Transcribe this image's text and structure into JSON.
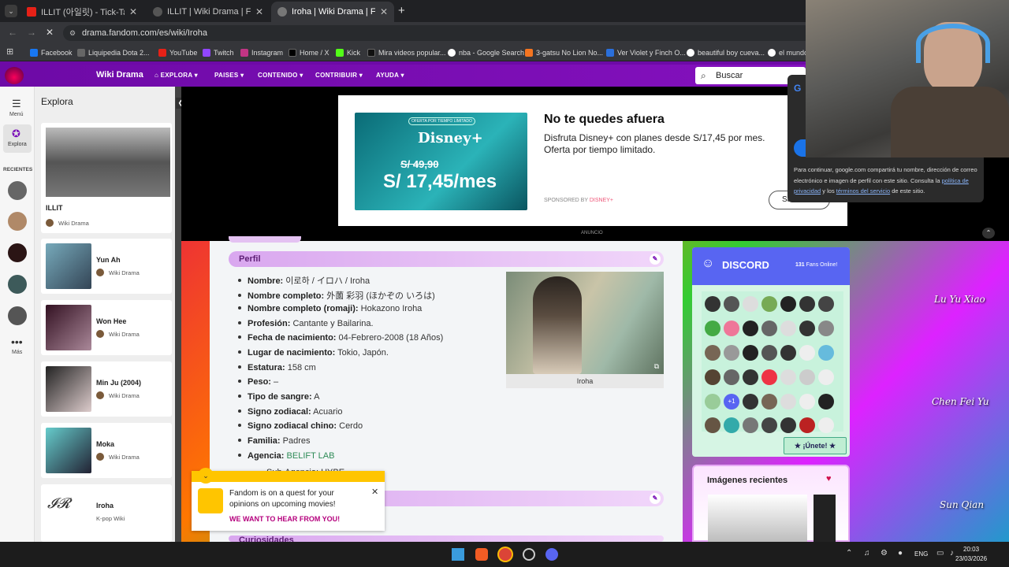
{
  "tabs": [
    {
      "title": "ILLIT (아일릿) - Tick-Tack @인기...",
      "color": "#e62117"
    },
    {
      "title": "ILLIT | Wiki Drama | Fandom",
      "color": "#444"
    },
    {
      "title": "Iroha | Wiki Drama | Fandom",
      "color": "#555"
    }
  ],
  "url": "drama.fandom.com/es/wiki/Iroha",
  "bookmarks": [
    "Facebook",
    "Liquipedia Dota 2...",
    "YouTube",
    "Twitch",
    "Instagram",
    "Home / X",
    "Kick",
    "Mira videos popular...",
    "nba - Google Search",
    "3-gatsu No Lion No...",
    "Ver Violet y Finch O...",
    "beautiful boy cueva...",
    "el mundo"
  ],
  "fandom": {
    "site": "Wiki Drama",
    "nav": [
      "EXPLORA",
      "PAISES",
      "CONTENIDO",
      "CONTRIBUIR",
      "AYUDA"
    ],
    "search": "Buscar"
  },
  "rail": {
    "menu": "Menú",
    "explora": "Explora",
    "recientes": "RECIENTES",
    "mas": "Más"
  },
  "explore": {
    "title": "Explora",
    "cards": [
      {
        "title": "ILLIT",
        "sub": "Wiki Drama"
      },
      {
        "title": "Yun Ah",
        "sub": "Wiki Drama"
      },
      {
        "title": "Won Hee",
        "sub": "Wiki Drama"
      },
      {
        "title": "Min Ju (2004)",
        "sub": "Wiki Drama"
      },
      {
        "title": "Moka",
        "sub": "Wiki Drama"
      },
      {
        "title": "Iroha",
        "sub": "K-pop Wiki"
      }
    ]
  },
  "ad": {
    "headline": "No te quedes afuera",
    "body": "Disfruta Disney+ con planes desde S/17,45 por mes. Oferta por tiempo limitado.",
    "sponsored": "SPONSORED BY",
    "brand": "DISNEY+",
    "old_price": "S/ 49,90",
    "price": "S/ 17,45/mes",
    "tag": "OFERTA POR TIEMPO LIMITADO",
    "label": "ANUNCIO",
    "cta": "Sa"
  },
  "google": {
    "text1": "Para continuar, google.com compartirá tu nombre, dirección de correo electrónico e imagen de perfil con este sitio. Consulta la ",
    "link1": "política de privacidad",
    "text2": " y los ",
    "link2": "términos del servicio",
    "text3": " de este sitio."
  },
  "profile": {
    "heading": "Perfil",
    "fields": [
      {
        "k": "Nombre:",
        "v": "이로하 / イロハ / Iroha"
      },
      {
        "k": "Nombre completo:",
        "v": "外薗 彩羽 (ほかぞの いろは)"
      },
      {
        "k": "Nombre completo (romaji):",
        "v": "Hokazono Iroha"
      },
      {
        "k": "Profesión:",
        "v": "Cantante y Bailarina."
      },
      {
        "k": "Fecha de nacimiento:",
        "v": "04-Febrero-2008 (18 Años)"
      },
      {
        "k": "Lugar de nacimiento:",
        "v": "Tokio, Japón."
      },
      {
        "k": "Estatura:",
        "v": "158 cm"
      },
      {
        "k": "Peso:",
        "v": "–"
      },
      {
        "k": "Tipo de sangre:",
        "v": "A"
      },
      {
        "k": "Signo zodiacal:",
        "v": "Acuario"
      },
      {
        "k": "Signo zodiacal chino:",
        "v": "Cerdo"
      },
      {
        "k": "Familia:",
        "v": "Padres"
      },
      {
        "k": "Agencia:",
        "v": "BELIFT LAB"
      }
    ],
    "sub_agency": "Sub-Agencia: HYBE",
    "caption": "Iroha",
    "next_heading": "Curiosidades"
  },
  "popup": {
    "text": "Fandom is on a quest for your opinions on upcoming movies!",
    "cta": "WE WANT TO HEAR FROM YOU!"
  },
  "discord": {
    "title": "DISCORD",
    "count": "131",
    "online": "Fans Online!",
    "join": "★ ¡Únete! ★",
    "plus": "+1"
  },
  "recent": {
    "title": "Imágenes recientes"
  },
  "side_names": [
    "Lu Yu Xiao",
    "Chen Fei Yu",
    "Sun Qian"
  ],
  "taskbar": {
    "lang": "ENG",
    "time": "20:03",
    "date": "23/03/2026"
  },
  "colors": {
    "fandom_purple": "#7a10b8",
    "link_green": "#2e8b57",
    "discord_blurple": "#5865f2"
  }
}
